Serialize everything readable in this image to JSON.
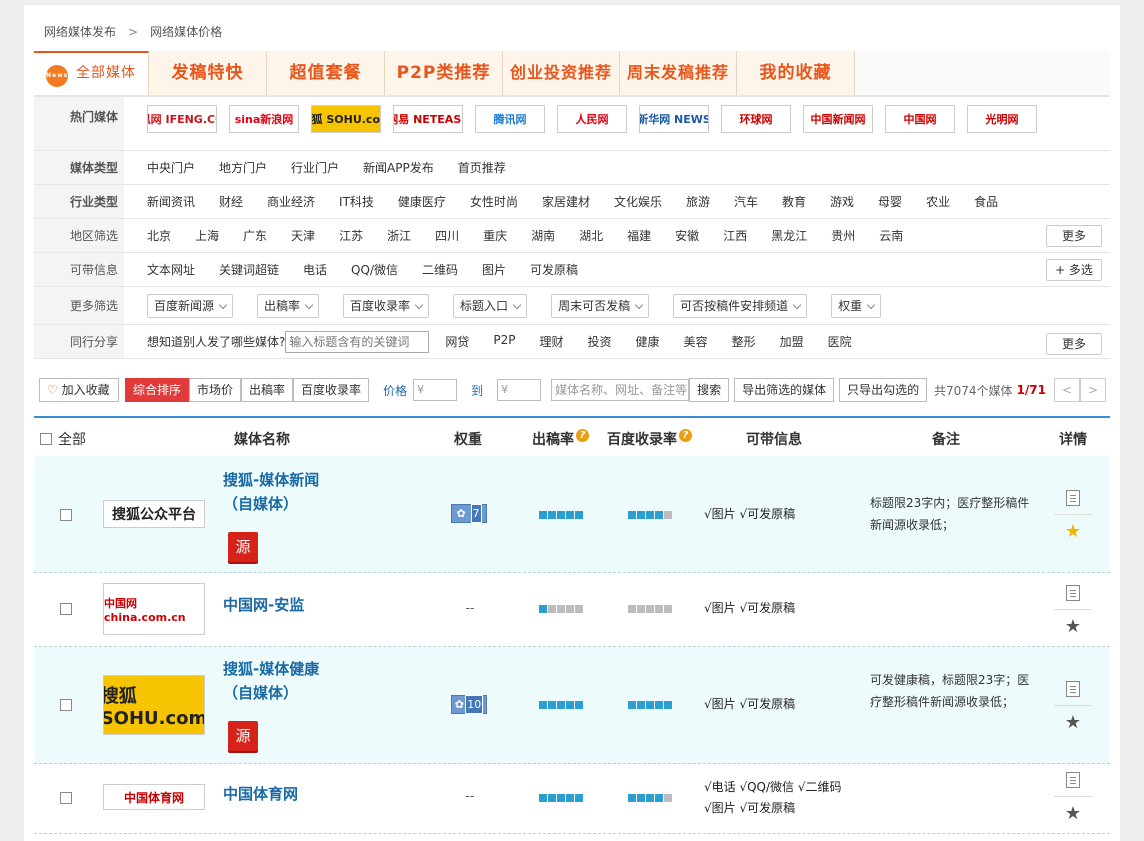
{
  "breadcrumb": {
    "root": "网络媒体发布",
    "sep": ">",
    "current": "网络媒体价格"
  },
  "nav": {
    "news_icon": "News",
    "tabs": [
      "全部媒体",
      "发稿特快",
      "超值套餐",
      "P2P类推荐",
      "创业投资推荐",
      "周末发稿推荐",
      "我的收藏"
    ]
  },
  "filters": {
    "hot_media": {
      "label": "热门媒体",
      "logos": [
        "凤凰网 IFENG.COM",
        "sina新浪网",
        "搜狐 SOHU.com",
        "网易 NETEASE",
        "腾讯网",
        "人民网",
        "新华网 NEWS",
        "环球网",
        "中国新闻网",
        "中国网",
        "光明网"
      ]
    },
    "media_type": {
      "label": "媒体类型",
      "items": [
        "中央门户",
        "地方门户",
        "行业门户",
        "新闻APP发布",
        "首页推荐"
      ]
    },
    "industry_type": {
      "label": "行业类型",
      "items": [
        "新闻资讯",
        "财经",
        "商业经济",
        "IT科技",
        "健康医疗",
        "女性时尚",
        "家居建材",
        "文化娱乐",
        "旅游",
        "汽车",
        "教育",
        "游戏",
        "母婴",
        "农业",
        "食品"
      ]
    },
    "region": {
      "label": "地区筛选",
      "items": [
        "北京",
        "上海",
        "广东",
        "天津",
        "江苏",
        "浙江",
        "四川",
        "重庆",
        "湖南",
        "湖北",
        "福建",
        "安徽",
        "江西",
        "黑龙江",
        "贵州",
        "云南"
      ],
      "more": "更多"
    },
    "extra_info": {
      "label": "可带信息",
      "items": [
        "文本网址",
        "关键词超链",
        "电话",
        "QQ/微信",
        "二维码",
        "图片",
        "可发原稿"
      ],
      "multi": "+ 多选"
    },
    "more_filters": {
      "label": "更多筛选",
      "dropdowns": [
        "百度新闻源",
        "出稿率",
        "百度收录率",
        "标题入口",
        "周末可否发稿",
        "可否按稿件安排频道",
        "权重"
      ]
    },
    "peer_share": {
      "label": "同行分享",
      "prompt": "想知道别人发了哪些媒体?",
      "placeholder": "输入标题含有的关键词",
      "items": [
        "网贷",
        "P2P",
        "理财",
        "投资",
        "健康",
        "美容",
        "整形",
        "加盟",
        "医院"
      ],
      "more": "更多"
    }
  },
  "toolbar": {
    "favorite": "加入收藏",
    "sorts": [
      "综合排序",
      "市场价",
      "出稿率",
      "百度收录率"
    ],
    "price_label": "价格",
    "price_min": "¥",
    "to_label": "到",
    "price_max": "¥",
    "search_placeholder": "媒体名称、网址、备注等",
    "search_btn": "搜索",
    "export_filtered": "导出筛选的媒体",
    "export_checked": "只导出勾选的",
    "total": "共7074个媒体",
    "page": "1/71",
    "prev": "<",
    "next": ">"
  },
  "table": {
    "headers": {
      "all": "全部",
      "name": "媒体名称",
      "weight": "权重",
      "publish_rate": "出稿率",
      "baidu_rate": "百度收录率",
      "info": "可带信息",
      "note": "备注",
      "detail": "详情",
      "help": "?"
    },
    "rows": [
      {
        "logo": "搜狐公众平台",
        "name": "搜狐-媒体新闻（自媒体）",
        "source": "源",
        "weight": "7",
        "publish_rate_level": 5,
        "baidu_rate_level": 4,
        "info": [
          "√图片 √可发原稿"
        ],
        "note": "标题限23字内；医疗整形稿件新闻源收录低；",
        "starred": true
      },
      {
        "logo": "中国网 china.com.cn",
        "name": "中国网-安监",
        "source": "",
        "weight": "--",
        "publish_rate_level": 1,
        "baidu_rate_level": 0,
        "info": [
          "√图片 √可发原稿"
        ],
        "note": "",
        "starred": false
      },
      {
        "logo": "搜狐 SOHU.com",
        "name": "搜狐-媒体健康（自媒体）",
        "source": "源",
        "weight": "10",
        "publish_rate_level": 5,
        "baidu_rate_level": 5,
        "info": [
          "√图片 √可发原稿"
        ],
        "note": "可发健康稿，标题限23字；医疗整形稿件新闻源收录低；",
        "starred": false
      },
      {
        "logo": "中国体育网",
        "name": "中国体育网",
        "source": "",
        "weight": "--",
        "publish_rate_level": 5,
        "baidu_rate_level": 4,
        "info": [
          "√电话 √QQ/微信 √二维码",
          "√图片 √可发原稿"
        ],
        "note": "",
        "starred": false
      }
    ],
    "star_icon": "★"
  },
  "colors": {
    "accent": "#e8561c",
    "link": "#1a6aa5",
    "sort_active": "#e13a3a",
    "bar_on": "#2b9fd1",
    "bar_off": "#bdbdbd",
    "row_alt": "#eefbfc"
  }
}
